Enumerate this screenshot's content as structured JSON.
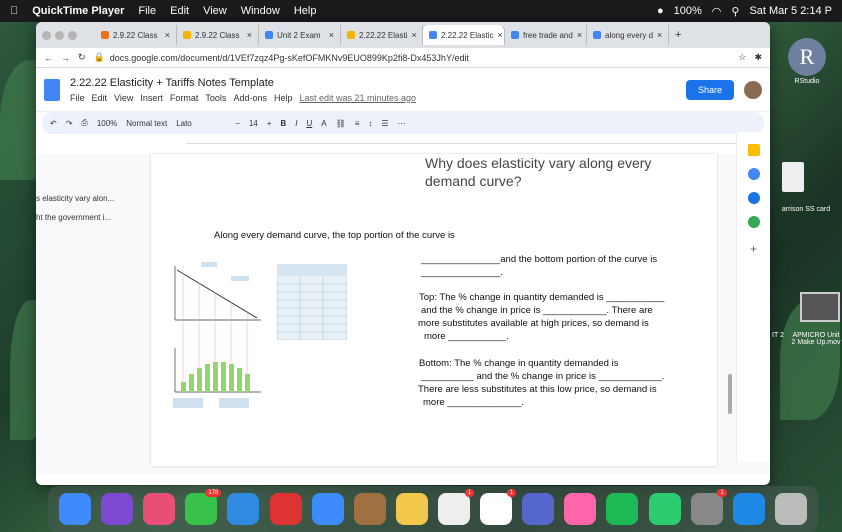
{
  "menubar": {
    "app": "QuickTime Player",
    "items": [
      "File",
      "Edit",
      "View",
      "Window",
      "Help"
    ],
    "battery": "100%",
    "datetime": "Sat Mar 5 2:14 P"
  },
  "tabs": [
    {
      "label": "2.9.22 Class",
      "color": "#e8711a"
    },
    {
      "label": "2.9.22 Class",
      "color": "#f4b400"
    },
    {
      "label": "Unit 2 Exam",
      "color": "#4285f4"
    },
    {
      "label": "2.22.22 Elasti",
      "color": "#f4b400"
    },
    {
      "label": "2.22.22 Elastic",
      "color": "#4285f4",
      "active": true
    },
    {
      "label": "free trade and",
      "color": "#4285f4"
    },
    {
      "label": "along every d",
      "color": "#4285f4"
    }
  ],
  "url": "docs.google.com/document/d/1VEf7zqz4Pg-sKefOFMKNv9EUO899Kp2fi8-Dx453JhY/edit",
  "doc": {
    "title": "2.22.22 Elasticity + Tariffs Notes Template",
    "menus": [
      "File",
      "Edit",
      "View",
      "Insert",
      "Format",
      "Tools",
      "Add-ons",
      "Help"
    ],
    "last_edit": "Last edit was 21 minutes ago",
    "share": "Share"
  },
  "toolbar": {
    "zoom": "100%",
    "style": "Normal text",
    "font": "Lato",
    "size": "14"
  },
  "outline": [
    "s elasticity vary alon...",
    "ht the government i..."
  ],
  "page": {
    "heading1": "Why does elasticity vary along every",
    "heading2": "demand  curve?",
    "intro": "Along every demand curve, the top portion of the curve is",
    "l1": "_______________and the bottom portion of the curve is",
    "l2": "_______________.",
    "top1": "Top: The % change in quantity demanded is ___________",
    "top2": "and the % change in price is ____________. There are",
    "top3": "more substitutes available at high prices, so demand is",
    "top4": "more ___________.",
    "bot1": "Bottom: The % change in quantity demanded is",
    "bot2": "__________ and the % change in price is ____________.",
    "bot3": "There are less substitutes at this low price, so demand is",
    "bot4": "more ______________."
  },
  "right": {
    "avatar": "R",
    "rstudio": "RStudio",
    "file1": "arrison SS card",
    "file2": "APMICRO Unit 2 Make Up.mov",
    "file3": "IT 2"
  },
  "dock": [
    {
      "c": "#3d8bfd"
    },
    {
      "c": "#7b4ad0"
    },
    {
      "c": "#e94e77"
    },
    {
      "c": "#39c24a",
      "badge": "178"
    },
    {
      "c": "#2f8ae0"
    },
    {
      "c": "#d33"
    },
    {
      "c": "#3d8bfd"
    },
    {
      "c": "#a07040"
    },
    {
      "c": "#f2c94c"
    },
    {
      "c": "#eee",
      "badge": "1"
    },
    {
      "c": "#fff",
      "badge": "1"
    },
    {
      "c": "#56c"
    },
    {
      "c": "#f6a"
    },
    {
      "c": "#1db954"
    },
    {
      "c": "#2ecc71"
    },
    {
      "c": "#888",
      "badge": "1"
    },
    {
      "c": "#1e88e5"
    },
    {
      "c": "#bbb"
    }
  ]
}
